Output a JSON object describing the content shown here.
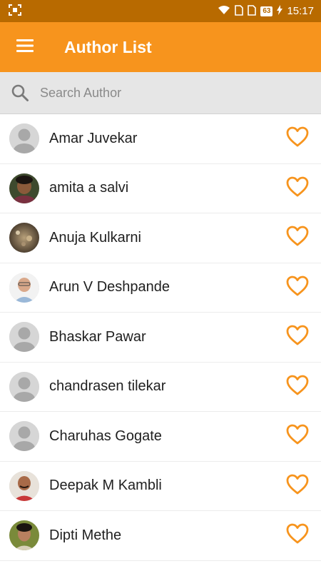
{
  "status_bar": {
    "battery": "63",
    "time": "15:17",
    "icons": [
      "screenshot-icon",
      "wifi-icon",
      "sim-icon",
      "sim-icon",
      "charging-icon"
    ]
  },
  "app_bar": {
    "title": "Author List",
    "menu_icon": "hamburger-menu-icon"
  },
  "search": {
    "placeholder": "Search Author",
    "value": ""
  },
  "colors": {
    "primary": "#f7941d",
    "status_bar": "#b86a00",
    "heart": "#f7941d"
  },
  "authors": [
    {
      "name": "Amar Juvekar",
      "avatar": "placeholder"
    },
    {
      "name": "amita a salvi",
      "avatar": "photo"
    },
    {
      "name": "Anuja Kulkarni",
      "avatar": "photo"
    },
    {
      "name": "Arun V Deshpande",
      "avatar": "photo"
    },
    {
      "name": "Bhaskar Pawar",
      "avatar": "placeholder"
    },
    {
      "name": "chandrasen tilekar",
      "avatar": "placeholder"
    },
    {
      "name": "Charuhas Gogate",
      "avatar": "placeholder"
    },
    {
      "name": "Deepak M Kambli",
      "avatar": "photo"
    },
    {
      "name": "Dipti Methe",
      "avatar": "photo"
    }
  ]
}
